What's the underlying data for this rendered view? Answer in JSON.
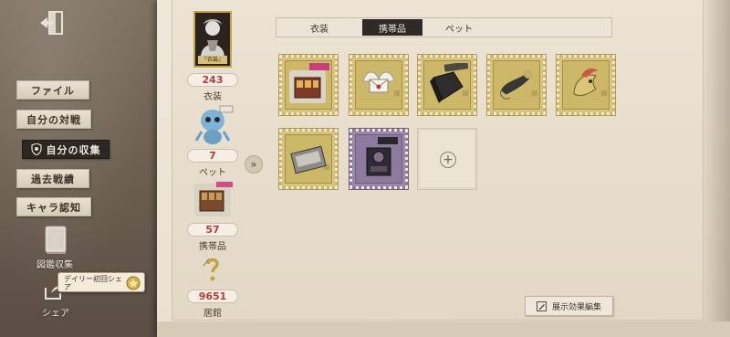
{
  "sidebar": {
    "items": [
      {
        "label": "ファイル"
      },
      {
        "label": "自分の対戦"
      },
      {
        "label": "自分の収集"
      },
      {
        "label": "過去戦績"
      },
      {
        "label": "キャラ認知"
      }
    ],
    "catalog_label": "図鑑収集",
    "share_label": "シェア",
    "daily_tooltip": "デイリー初回シェア"
  },
  "stats": {
    "costume_count": "243",
    "costume_label": "衣装",
    "costume_badge": "『衣装』",
    "pet_count": "7",
    "pet_label": "ペット",
    "item_count": "57",
    "item_label": "携帯品",
    "house_count": "9651",
    "house_label": "居館"
  },
  "tabs": [
    {
      "label": "衣装",
      "active": false
    },
    {
      "label": "携帯品",
      "active": true
    },
    {
      "label": "ペット",
      "active": false
    }
  ],
  "grid": {
    "add_symbol": "+"
  },
  "edit_button_label": "展示効果編集",
  "colors": {
    "accent_red": "#b43d3d",
    "gold_stamp": "#cdb86a",
    "purple_stamp": "#8d7b9e",
    "active_tab": "#2f2a25"
  }
}
